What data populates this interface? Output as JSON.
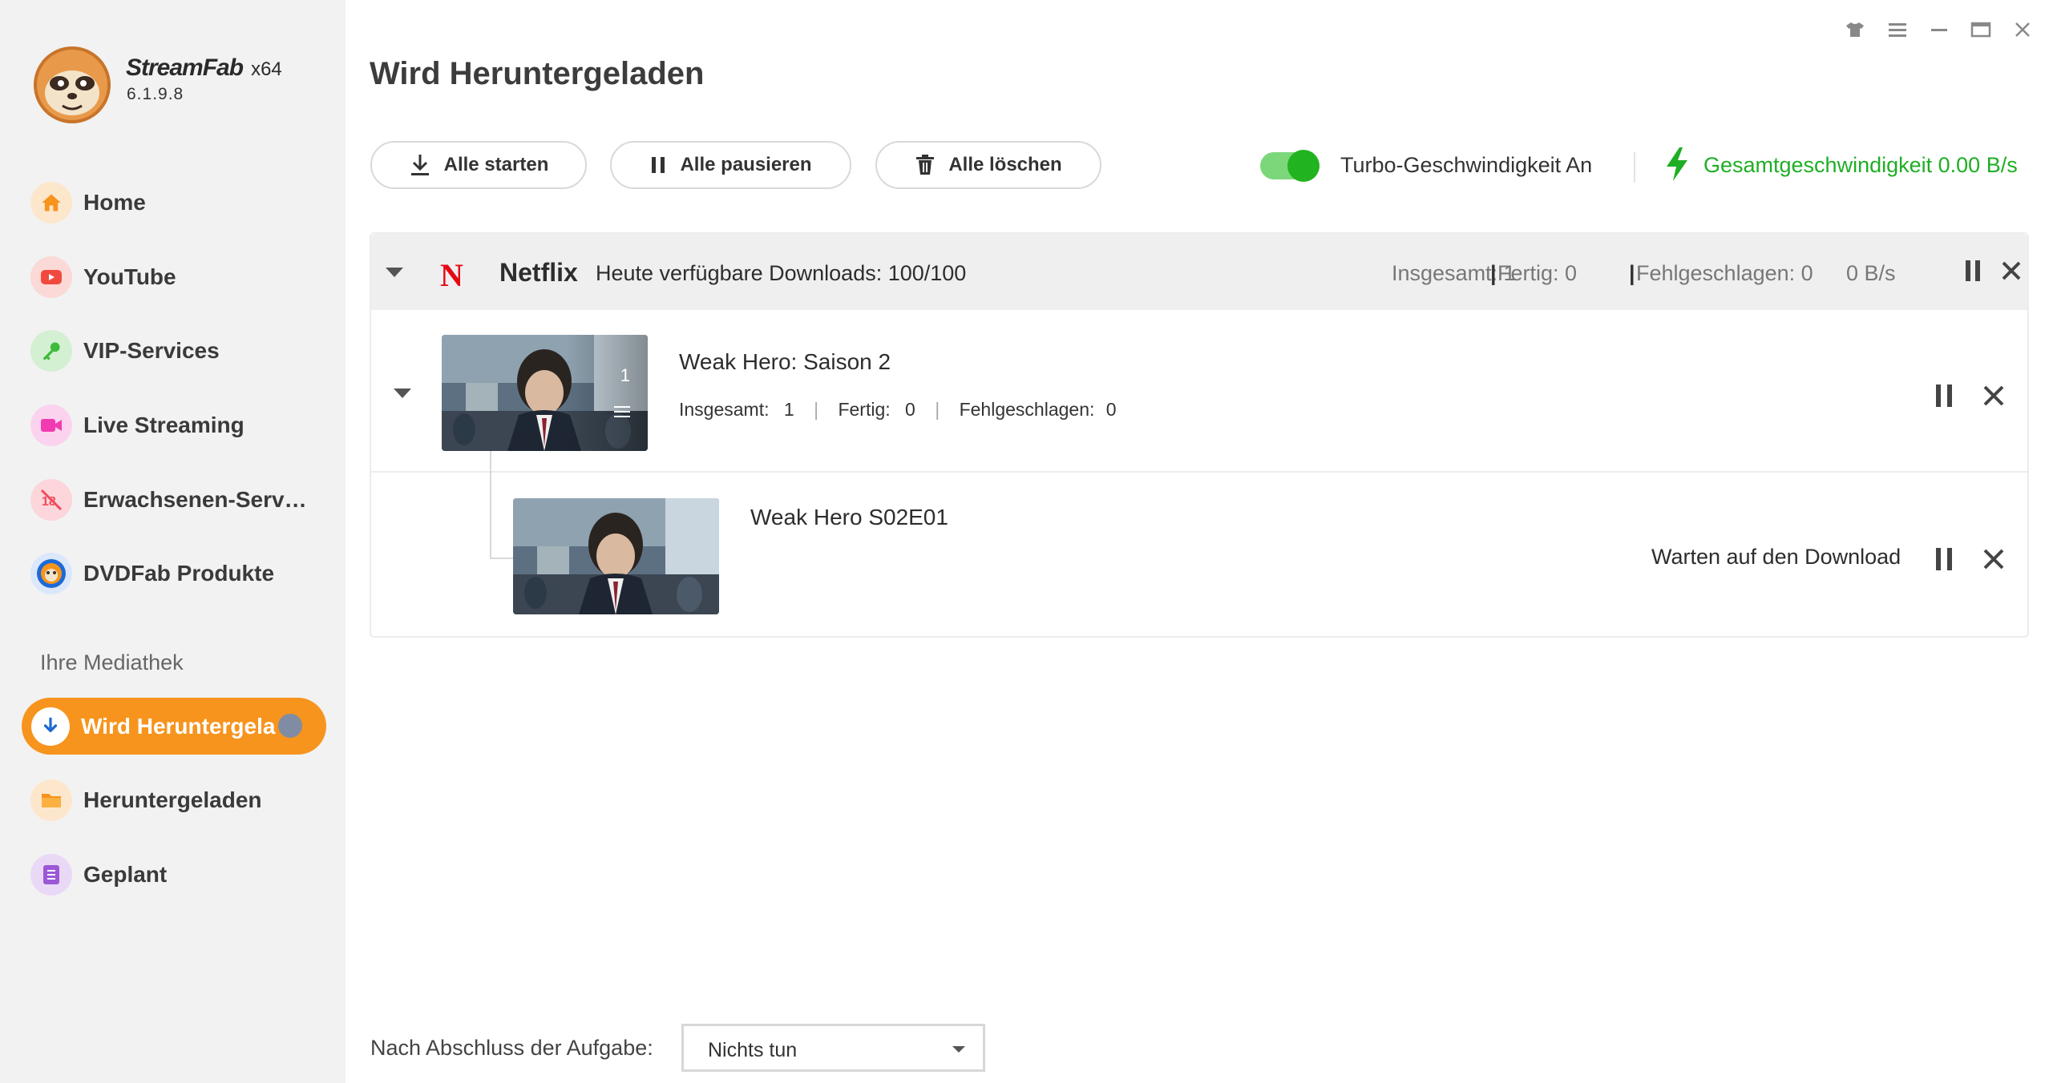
{
  "app": {
    "name": "StreamFab",
    "arch": "x64",
    "version": "6.1.9.8"
  },
  "sidebar": {
    "items": [
      {
        "label": "Home",
        "icon": "home-icon",
        "color": "#f7941d"
      },
      {
        "label": "YouTube",
        "icon": "youtube-icon",
        "color": "#f04a3f"
      },
      {
        "label": "VIP-Services",
        "icon": "key-icon",
        "color": "#3dbb3a"
      },
      {
        "label": "Live Streaming",
        "icon": "camera-icon",
        "color": "#f23bb2"
      },
      {
        "label": "Erwachsenen-Serv…",
        "icon": "adult-icon",
        "color": "#f24a5c"
      },
      {
        "label": "DVDFab Produkte",
        "icon": "dvdfab-icon",
        "color": "#1e6ad6"
      }
    ],
    "library_label": "Ihre Mediathek",
    "library": [
      {
        "label": "Wird Heruntergela",
        "icon": "download-icon",
        "active": true
      },
      {
        "label": "Heruntergeladen",
        "icon": "folder-icon",
        "color": "#f7941d"
      },
      {
        "label": "Geplant",
        "icon": "list-icon",
        "color": "#9d58d6"
      }
    ]
  },
  "header": {
    "title": "Wird Heruntergeladen"
  },
  "toolbar": {
    "start_all": "Alle starten",
    "pause_all": "Alle pausieren",
    "delete_all": "Alle löschen",
    "turbo_label": "Turbo-Geschwindigkeit An",
    "turbo_on": true,
    "total_speed": "Gesamtgeschwindigkeit 0.00 B/s"
  },
  "group": {
    "service": "Netflix",
    "quota": "Heute verfügbare Downloads: 100/100",
    "total": "Insgesamt: 1",
    "done": "Fertig: 0",
    "failed": "Fehlgeschlagen: 0",
    "speed": "0 B/s",
    "season": {
      "title": "Weak Hero: Saison 2",
      "total_label": "Insgesamt:",
      "total_value": "1",
      "done_label": "Fertig:",
      "done_value": "0",
      "failed_label": "Fehlgeschlagen:",
      "failed_value": "0",
      "badge": "1"
    },
    "episode": {
      "title": "Weak Hero S02E01",
      "status": "Warten auf den Download"
    }
  },
  "footer": {
    "after_task_label": "Nach Abschluss der Aufgabe:",
    "after_task_value": "Nichts tun"
  },
  "colors": {
    "accent": "#f7941d",
    "success": "#1fae25",
    "netflix": "#e50914"
  }
}
